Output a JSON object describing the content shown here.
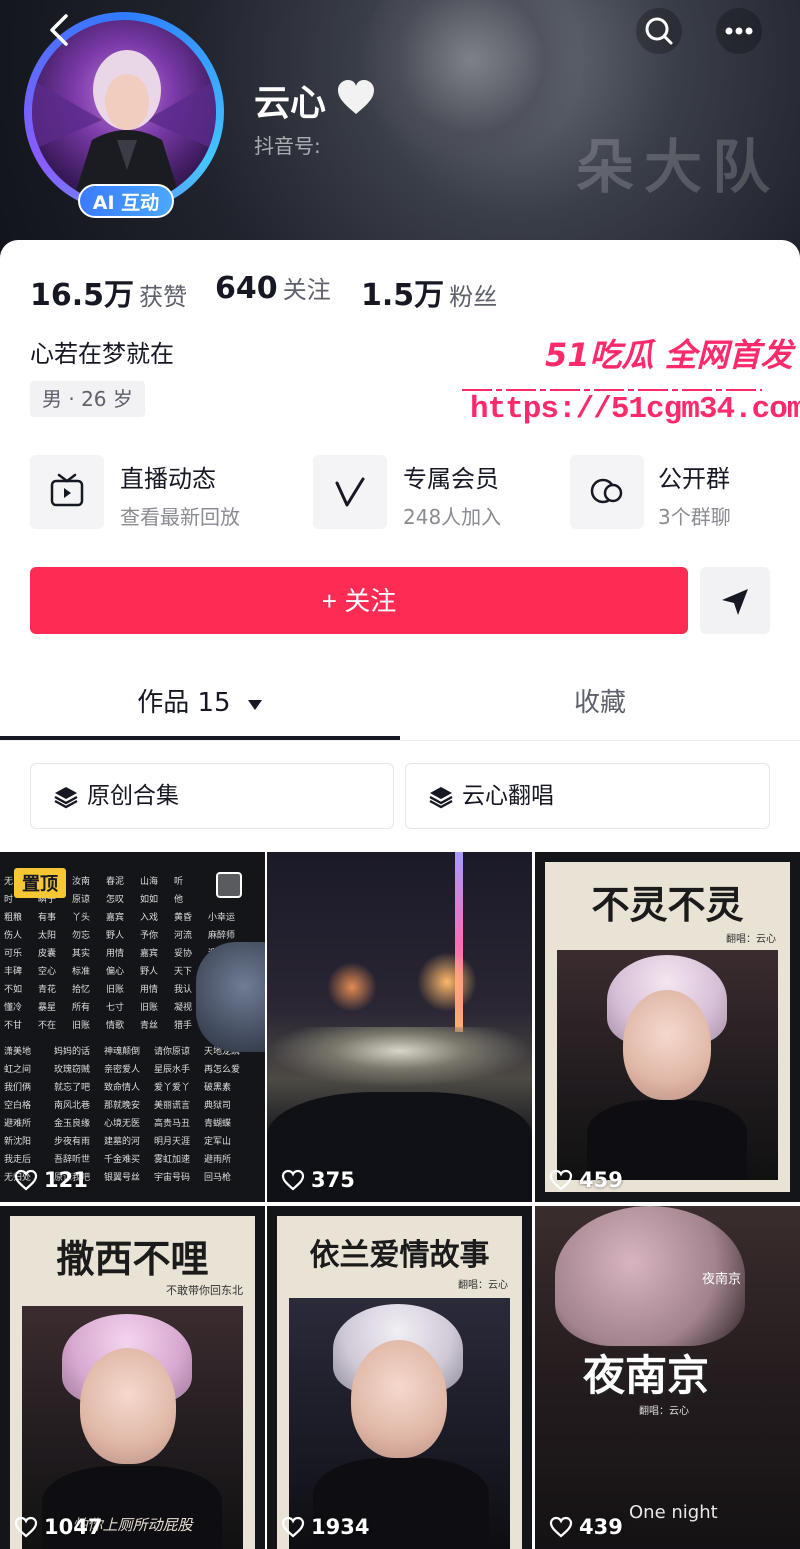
{
  "profile": {
    "name": "云心",
    "douyin_id_label": "抖音号:",
    "ai_badge": "AI 互动",
    "hero_text": "朵大队",
    "bio": "心若在梦就在",
    "tag": "男 · 26 岁"
  },
  "stats": [
    {
      "value": "16.5万",
      "label": "获赞"
    },
    {
      "value": "640",
      "label": "关注"
    },
    {
      "value": "1.5万",
      "label": "粉丝"
    }
  ],
  "watermark": {
    "title": "51吃瓜 全网首发",
    "url": "https://51cgm34.com"
  },
  "features": [
    {
      "title": "直播动态",
      "sub": "查看最新回放",
      "icon": "tv-icon"
    },
    {
      "title": "专属会员",
      "sub": "248人加入",
      "icon": "v-member-icon"
    },
    {
      "title": "公开群",
      "sub": "3个群聊",
      "icon": "chat-group-icon"
    }
  ],
  "actions": {
    "follow": "+ 关注"
  },
  "tabs": {
    "works": "作品 15",
    "favorites": "收藏"
  },
  "collections": [
    "原创合集",
    "云心翻唱"
  ],
  "videos": [
    {
      "likes": "121",
      "pinned": "置顶"
    },
    {
      "likes": "375"
    },
    {
      "likes": "459",
      "title": "不灵不灵",
      "credit": "翻唱：云心"
    },
    {
      "likes": "1047",
      "title": "撒西不哩",
      "subtitle": "不敢带你回东北",
      "caption": "怕你上厕所动屁股"
    },
    {
      "likes": "1934",
      "title": "依兰爱情故事",
      "credit": "翻唱：云心"
    },
    {
      "likes": "439",
      "title": "夜南京",
      "small_title": "夜南京",
      "credit": "翻唱：云心",
      "footer": "One night"
    }
  ],
  "song_list": [
    [
      "无",
      "爱错",
      "汝南",
      "春泥",
      "山海",
      "听"
    ],
    [
      "时",
      "瞬子",
      "原谅",
      "怎叹",
      "如如",
      "他"
    ],
    [
      "粗粮",
      "有事",
      "丫头",
      "嘉宾",
      "入戏",
      "黄昏",
      "小幸运"
    ],
    [
      "伤人",
      "太阳",
      "勿忘",
      "野人",
      "予你",
      "河流",
      "麻醉师"
    ],
    [
      "可乐",
      "皮囊",
      "其实",
      "用情",
      "嘉宾",
      "妥协",
      "遗址"
    ],
    [
      "丰碑",
      "空心",
      "标准",
      "偏心",
      "野人",
      "天下"
    ],
    [
      "不如",
      "青花",
      "拾忆",
      "旧账",
      "用情",
      "我认"
    ],
    [
      "懂冷",
      "暴星",
      "所有",
      "七寸",
      "旧账",
      "凝视"
    ],
    [
      "不甘",
      "不在",
      "旧账",
      "情歌",
      "青丝",
      "猎手"
    ],
    [
      "潇美地",
      "妈妈的话",
      "神魂颠倒",
      "请你原谅",
      "天地龙鳞"
    ],
    [
      "虹之间",
      "玫瑰窃贼",
      "亲密爱人",
      "星辰水手",
      "再怎么爱"
    ],
    [
      "我们俩",
      "就忘了吧",
      "致命情人",
      "爱丫爱丫",
      "破黑素"
    ],
    [
      "空白格",
      "南风北巷",
      "那就晚安",
      "美丽谎言",
      "典狱司"
    ],
    [
      "避难所",
      "金玉良缘",
      "心境无医",
      "高贵马丑",
      "青蝴蝶"
    ],
    [
      "新沈阳",
      "步夜有雨",
      "建墓的河",
      "明月天涯",
      "定军山"
    ],
    [
      "我走后",
      "吾辞听世",
      "千金难买",
      "雾虹加速",
      "避雨所"
    ],
    [
      "无归处",
      "原谅我吧",
      "银翼号丝",
      "宇宙号码",
      "回马枪"
    ]
  ]
}
